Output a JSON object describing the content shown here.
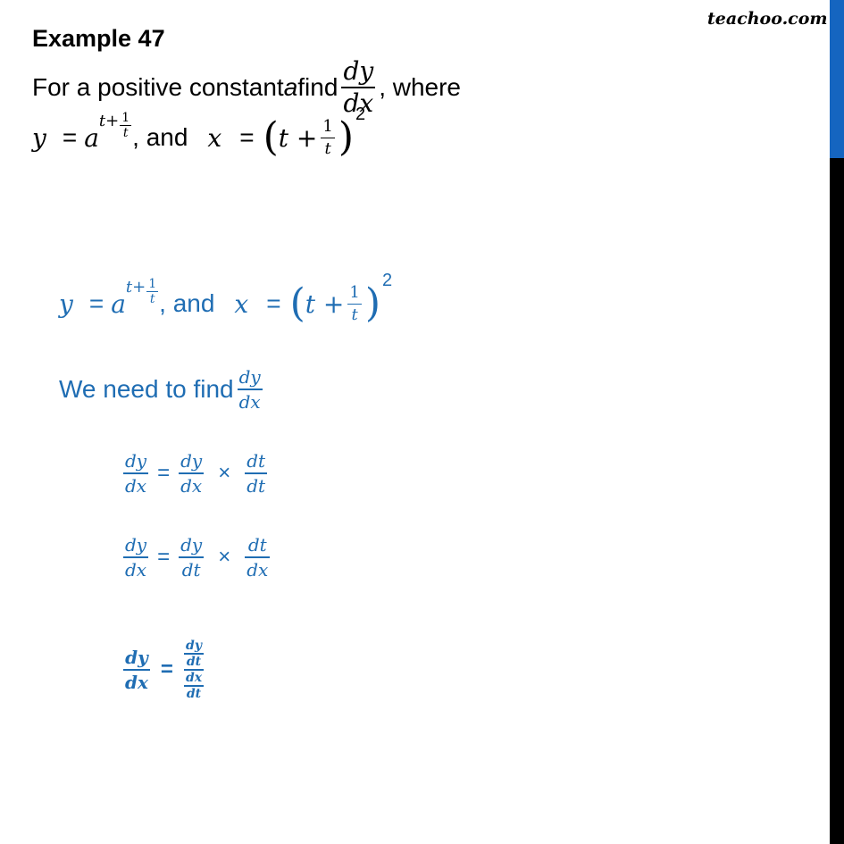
{
  "brand": {
    "logo_text": "teachoo.com"
  },
  "question": {
    "title": "Example 47",
    "line1_prefix": "For a positive constant ",
    "line1_var": "a",
    "line1_find": " find ",
    "line1_suffix": ", where",
    "dy": "dy",
    "dx": "dx",
    "y_var": "y",
    "x_var": "x",
    "eq": "=",
    "a_base": "a",
    "exp_t": "t+",
    "one": "1",
    "t": "t",
    "and_text": ", and",
    "t_plus": "t +",
    "power": "2"
  },
  "solution": {
    "need_text": "We need to find",
    "dt": "dt",
    "times": "×",
    "eq": "=",
    "step1": {
      "lhs": [
        "dy",
        "dx"
      ],
      "r1": [
        "dy",
        "dx"
      ],
      "r2": [
        "dt",
        "dt"
      ]
    },
    "step2": {
      "lhs": [
        "dy",
        "dx"
      ],
      "r1": [
        "dy",
        "dt"
      ],
      "r2": [
        "dt",
        "dx"
      ]
    },
    "step3": {
      "lhs": [
        "dy",
        "dx"
      ],
      "top": [
        "dy",
        "dt"
      ],
      "bottom": [
        "dx",
        "dt"
      ]
    }
  },
  "colors": {
    "accent": "#1f6db3",
    "scroll_thumb": "#1565c0",
    "scroll_track": "#000000"
  }
}
